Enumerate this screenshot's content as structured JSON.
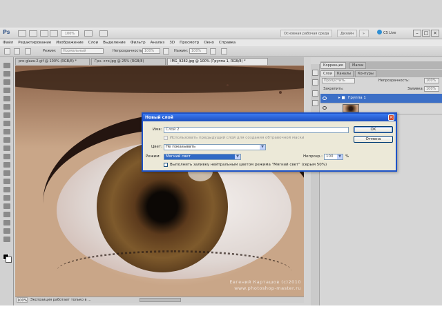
{
  "app": {
    "logo": "Ps",
    "zoom": "100%",
    "workspace_label": "Основная рабочая среда",
    "design_label": "Дизайн",
    "cs_live": "CS Live"
  },
  "menu": [
    "Файл",
    "Редактирование",
    "Изображение",
    "Слои",
    "Выделение",
    "Фильтр",
    "Анализ",
    "3D",
    "Просмотр",
    "Окно",
    "Справка"
  ],
  "options": {
    "mode_label": "Режим:",
    "mode_value": "Нормальный",
    "opacity_label": "Непрозрачность:",
    "opacity_value": "100%",
    "flow_label": "Нажим:",
    "flow_value": "100%"
  },
  "tabs": [
    "pro-glaza-2.gif @ 100% (RGB/8) *",
    "Грн. кто.jpg @ 25% (RGB/8)",
    "IMG_9282.jpg @ 100% (Группа 1, RGB/8) *"
  ],
  "canvas": {
    "watermark_line1": "Евгений Карташов (c)2010",
    "watermark_line2": "www.photoshop-master.ru"
  },
  "status": {
    "zoom": "100%",
    "info": "Экспозиция работает только в ..."
  },
  "panels": {
    "tab_correction": "Коррекция",
    "tab_masks": "Маски",
    "tab_layers": "Слои",
    "tab_channels": "Каналы",
    "tab_paths": "Контуры",
    "blend_mode": "Пропустить",
    "opacity_label": "Непрозрачность:",
    "opacity_value": "100%",
    "lock_label": "Закрепить:",
    "fill_label": "Заливка:",
    "fill_value": "100%",
    "layers": [
      {
        "name": "Группа 1",
        "selected": true
      },
      {
        "name": "",
        "selected": false
      }
    ]
  },
  "dialog": {
    "title": "Новый слой",
    "name_label": "Имя:",
    "name_value": "Слой 2",
    "clip_label": "Использовать предыдущий слой для создания обтравочной маски",
    "color_label": "Цвет:",
    "color_value": "Не показывать",
    "mode_label": "Режим:",
    "mode_value": "Мягкий свет",
    "opacity_label": "Непрозр.:",
    "opacity_value": "100",
    "opacity_unit": "%",
    "fill_label": "Выполнить заливку нейтральным цветом режима \"Мягкий свет\" (серым 50%)",
    "ok_label": "OK",
    "cancel_label": "Отмена"
  },
  "colors": {
    "dialog_title": "#1d4fc0",
    "selection": "#316ac5",
    "layer_selected": "#3c6fc6"
  }
}
